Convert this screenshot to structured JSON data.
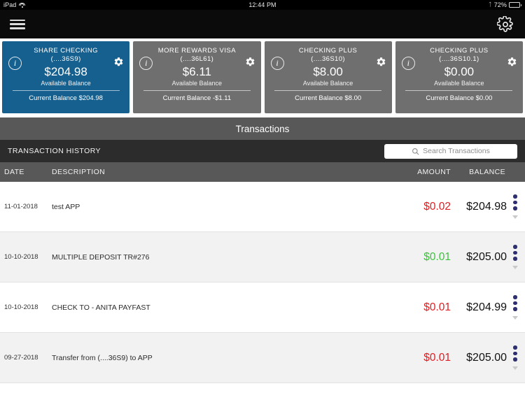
{
  "statusbar": {
    "device": "iPad",
    "wifi_icon": "wifi-icon",
    "time": "12:44 PM",
    "bluetooth_icon": "bluetooth-icon",
    "battery_percent": "72%",
    "battery_icon": "battery-icon"
  },
  "navbar": {
    "menu_icon": "hamburger-menu-icon",
    "settings_icon": "gear-icon"
  },
  "accounts": [
    {
      "name": "SHARE CHECKING",
      "number": "(....36S9)",
      "available_amount": "$204.98",
      "available_label": "Available Balance",
      "current_balance": "Current Balance $204.98",
      "theme": "blue",
      "color": "#15608f",
      "info_icon": "info-icon",
      "settings_icon": "gear-icon"
    },
    {
      "name": "MORE REWARDS VISA",
      "number": "(....36L61)",
      "available_amount": "$6.11",
      "available_label": "Available Balance",
      "current_balance": "Current Balance -$1.11",
      "theme": "gray",
      "color": "#6f6f6f",
      "info_icon": "info-icon",
      "settings_icon": "gear-icon"
    },
    {
      "name": "CHECKING PLUS",
      "number": "(....36S10)",
      "available_amount": "$8.00",
      "available_label": "Available Balance",
      "current_balance": "Current Balance $8.00",
      "theme": "gray",
      "color": "#6f6f6f",
      "info_icon": "info-icon",
      "settings_icon": "gear-icon"
    },
    {
      "name": "CHECKING PLUS",
      "number": "(....36S10.1)",
      "available_amount": "$0.00",
      "available_label": "Available Balance",
      "current_balance": "Current Balance $0.00",
      "theme": "gray",
      "color": "#6f6f6f",
      "info_icon": "info-icon",
      "settings_icon": "gear-icon"
    }
  ],
  "section": {
    "title": "Transactions"
  },
  "history": {
    "label": "TRANSACTION HISTORY",
    "search_placeholder": "Search Transactions",
    "search_value": "",
    "search_icon": "search-icon"
  },
  "table": {
    "columns": {
      "date": "DATE",
      "description": "DESCRIPTION",
      "amount": "AMOUNT",
      "balance": "BALANCE"
    },
    "rows": [
      {
        "date": "11-01-2018",
        "description": "test APP",
        "amount": "$0.02",
        "amount_type": "debit",
        "balance": "$204.98",
        "menu_icon": "more-options-icon",
        "expand_icon": "chevron-down-icon"
      },
      {
        "date": "10-10-2018",
        "description": "MULTIPLE DEPOSIT TR#276",
        "amount": "$0.01",
        "amount_type": "credit",
        "balance": "$205.00",
        "menu_icon": "more-options-icon",
        "expand_icon": "chevron-down-icon"
      },
      {
        "date": "10-10-2018",
        "description": "CHECK TO - ANITA PAYFAST",
        "amount": "$0.01",
        "amount_type": "debit",
        "balance": "$204.99",
        "menu_icon": "more-options-icon",
        "expand_icon": "chevron-down-icon"
      },
      {
        "date": "09-27-2018",
        "description": "Transfer from (....36S9) to APP",
        "amount": "$0.01",
        "amount_type": "debit",
        "balance": "$205.00",
        "menu_icon": "more-options-icon",
        "expand_icon": "chevron-down-icon"
      }
    ]
  },
  "colors": {
    "accent_blue": "#15608f",
    "card_gray": "#6f6f6f",
    "debit_red": "#e01d22",
    "credit_green": "#3ec23e",
    "menu_dot": "#2e2f70",
    "header_gray": "#585858",
    "history_bar": "#2c2c2c"
  }
}
